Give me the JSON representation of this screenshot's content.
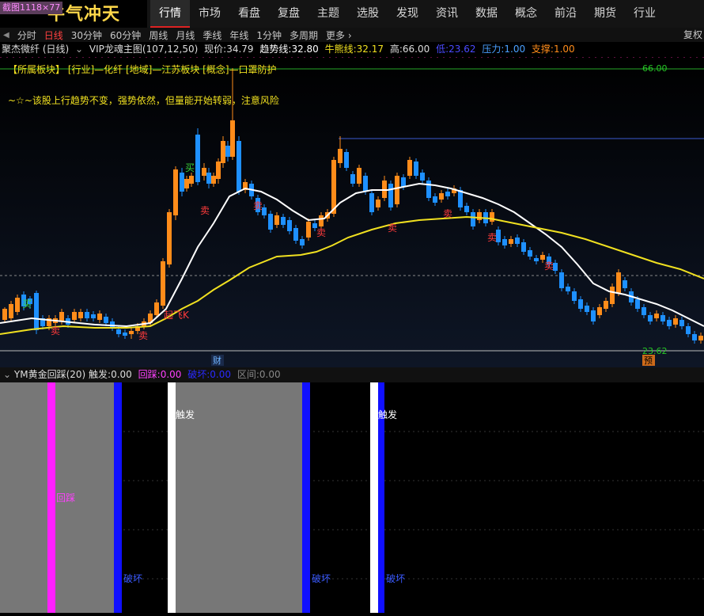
{
  "badge": "截图1118×77",
  "logo": "牛气冲天",
  "nav": [
    "行情",
    "市场",
    "看盘",
    "复盘",
    "主题",
    "选股",
    "发现",
    "资讯",
    "数据",
    "概念",
    "前沿",
    "期货",
    "行业"
  ],
  "nav_active": 0,
  "periods": [
    "分时",
    "日线",
    "30分钟",
    "60分钟",
    "周线",
    "月线",
    "季线",
    "年线",
    "1分钟",
    "多周期",
    "更多 ›"
  ],
  "period_active": 1,
  "period_right": "复权",
  "info": {
    "stock": "聚杰微纤 (日线)",
    "indicator": "VIP龙魂主图(107,12,50)",
    "price_label": "现价:",
    "price": "34.79",
    "trend_label": "趋势线:",
    "trend": "32.80",
    "bull_label": "牛熊线:",
    "bull": "32.17",
    "high_label": "高:",
    "high": "66.00",
    "low_label": "低:",
    "low": "23.62",
    "pressure_label": "压力:",
    "pressure": "1.00",
    "support_label": "支撑:",
    "support": "1.00"
  },
  "chart": {
    "sector_line": "【所属板块】 [行业]—化纤 [地域]—江苏板块 [概念]—口罩防护",
    "comment": "~☆~该股上行趋势不变，强势依然，但量能开始转弱，注意风险",
    "label_high": "66.00",
    "label_low": "23.62",
    "label_cai": "财",
    "label_yu": "预",
    "marks": [
      {
        "text": "卖",
        "color": "#ff3b3b"
      },
      {
        "text": "买",
        "color": "#3bd43b"
      },
      {
        "text": "卖",
        "color": "#ff3b3b"
      },
      {
        "text": "起飞K",
        "color": "#ff3b3b"
      },
      {
        "text": "买",
        "color": "#3bd43b"
      },
      {
        "text": "卖",
        "color": "#ff3b3b"
      },
      {
        "text": "卖",
        "color": "#ff3b3b"
      },
      {
        "text": "卖",
        "color": "#ff3b3b"
      },
      {
        "text": "卖",
        "color": "#ff3b3b"
      },
      {
        "text": "卖",
        "color": "#ff3b3b"
      },
      {
        "text": "卖",
        "color": "#ff3b3b"
      },
      {
        "text": "卖",
        "color": "#ff3b3b"
      }
    ],
    "colors": {
      "up": "#ff8c1a",
      "down": "#1e90ff",
      "trend": "#ffffff",
      "bull": "#f0e020",
      "grid": "#444"
    }
  },
  "sub": {
    "name": "YM黄金回踩(20)",
    "trig_label": "触发:",
    "trig": "0.00",
    "pull_label": "回踩:",
    "pull": "0.00",
    "break_label": "破坏:",
    "break": "0.00",
    "range_label": "区间:",
    "range": "0.00",
    "label_trigger": "触发",
    "label_pullback": "回踩",
    "label_break": "破坏"
  }
}
